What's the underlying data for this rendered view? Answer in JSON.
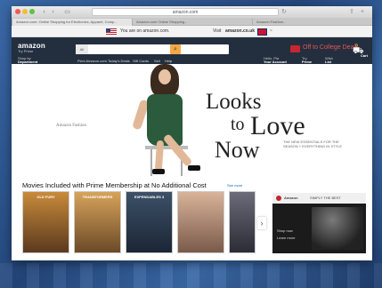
{
  "browser": {
    "url": "amazon.com",
    "tabs": [
      "Amazon.com: Online Shopping for Electronics, Apparel, Comp...",
      "Amazon.com Online Shopping...",
      "Amazon Fashion..."
    ]
  },
  "promo_bar": {
    "us_text": "You are on amazon.com.",
    "uk_prefix": "Visit",
    "uk_site": "amazon.co.uk",
    "close": "×"
  },
  "header": {
    "logo": "amazon",
    "logo_sub": "Try Prime",
    "search_category": "All",
    "search_placeholder": "",
    "deal_text": "Off to College Deals",
    "shop_by_1": "Shop by",
    "shop_by_2": "Department",
    "nav_links": [
      "Pia's Amazon.com",
      "Today's Deals",
      "Gift Cards",
      "Sell",
      "Help"
    ],
    "hello_1": "Hello, Pia",
    "hello_2": "Your Account",
    "try_1": "Try",
    "try_2": "Prime",
    "wish_1": "Wish",
    "wish_2": "List",
    "cart_count": "0",
    "cart_label": "Cart"
  },
  "hero": {
    "tagline": "Amazon Fashion",
    "line1": "Looks",
    "line2": "to",
    "line3": "Love",
    "line4": "Now",
    "sub": "THE NEW ESSENTIALS FOR THE SEASON + EVERYTHING IN STYLE"
  },
  "movies": {
    "title": "Movies Included with Prime Membership at No Additional Cost",
    "see_more": "See more",
    "items": [
      {
        "title": "OLD FURY",
        "color1": "#c98a3a",
        "color2": "#5a3a1e"
      },
      {
        "title": "TRANSFORMERS",
        "color1": "#d7a35a",
        "color2": "#6b4a28"
      },
      {
        "title": "EXPENDABLES 3",
        "color1": "#3d5068",
        "color2": "#1b2635"
      },
      {
        "title": "",
        "color1": "#d9b39a",
        "color2": "#7a5a4a"
      },
      {
        "title": "",
        "color1": "#6b6b7a",
        "color2": "#2c2c36"
      }
    ],
    "next": "›"
  },
  "ad": {
    "brand": "Amazon",
    "headline": "SIMPLY THE BEST",
    "cta_1": "Shop now",
    "cta_2": "Learn more"
  }
}
